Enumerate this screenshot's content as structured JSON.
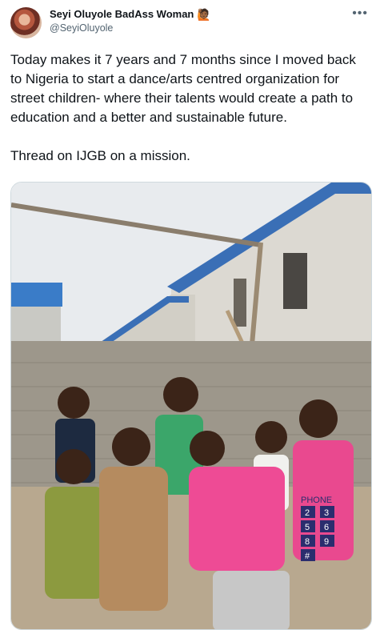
{
  "author": {
    "name": "Seyi Oluyole BadAss Woman",
    "emoji": "🙋🏾",
    "handle": "@SeyiOluyole",
    "avatar_icon": "profile-photo"
  },
  "more_icon": "more-options-icon",
  "more_glyph": "•••",
  "tweet_text": "Today makes it 7 years and 7 months since I moved back to Nigeria to start a dance/arts centred organization for street children- where their talents would create a path to education and a better and sustainable future.\n\nThread on IJGB on a mission.",
  "media": {
    "jersey_numbers": [
      "2",
      "3",
      "5",
      "6",
      "8",
      "9",
      "#"
    ],
    "jersey_text": "PHONE",
    "colors": {
      "sky": "#e8ebee",
      "wall": "#9d978b",
      "ground": "#b8a88f",
      "roof": "#3a6fb6",
      "pink_shirt": "#e9498f",
      "green_shirt": "#3ba66a"
    }
  }
}
